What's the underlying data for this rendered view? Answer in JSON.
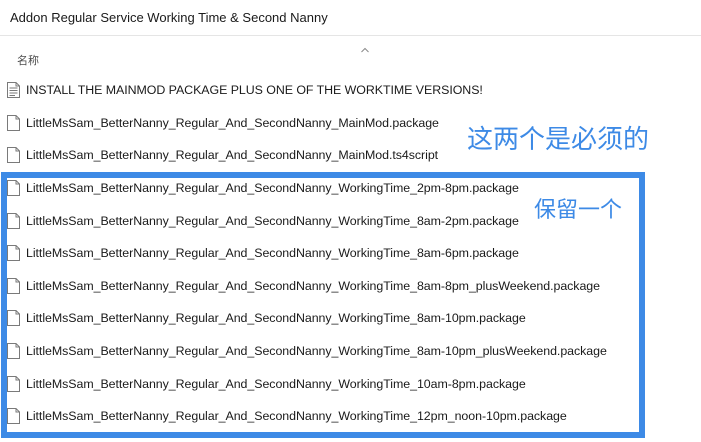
{
  "window": {
    "title": "Addon Regular Service Working Time & Second Nanny"
  },
  "column_header": {
    "name_label": "名称",
    "sort_icon": "chevron-up-icon"
  },
  "files": [
    {
      "name": "INSTALL THE MAINMOD PACKAGE PLUS ONE OF THE WORKTIME VERSIONS!",
      "icon": "text-document-icon"
    },
    {
      "name": "LittleMsSam_BetterNanny_Regular_And_SecondNanny_MainMod.package",
      "icon": "file-icon"
    },
    {
      "name": "LittleMsSam_BetterNanny_Regular_And_SecondNanny_MainMod.ts4script",
      "icon": "file-icon"
    },
    {
      "name": "LittleMsSam_BetterNanny_Regular_And_SecondNanny_WorkingTime_2pm-8pm.package",
      "icon": "file-icon"
    },
    {
      "name": "LittleMsSam_BetterNanny_Regular_And_SecondNanny_WorkingTime_8am-2pm.package",
      "icon": "file-icon"
    },
    {
      "name": "LittleMsSam_BetterNanny_Regular_And_SecondNanny_WorkingTime_8am-6pm.package",
      "icon": "file-icon"
    },
    {
      "name": "LittleMsSam_BetterNanny_Regular_And_SecondNanny_WorkingTime_8am-8pm_plusWeekend.package",
      "icon": "file-icon"
    },
    {
      "name": "LittleMsSam_BetterNanny_Regular_And_SecondNanny_WorkingTime_8am-10pm.package",
      "icon": "file-icon"
    },
    {
      "name": "LittleMsSam_BetterNanny_Regular_And_SecondNanny_WorkingTime_8am-10pm_plusWeekend.package",
      "icon": "file-icon"
    },
    {
      "name": "LittleMsSam_BetterNanny_Regular_And_SecondNanny_WorkingTime_10am-8pm.package",
      "icon": "file-icon"
    },
    {
      "name": "LittleMsSam_BetterNanny_Regular_And_SecondNanny_WorkingTime_12pm_noon-10pm.package",
      "icon": "file-icon"
    }
  ],
  "annotations": {
    "required": "这两个是必须的",
    "keep_one": "保留一个",
    "color": "#3d8ae6"
  }
}
